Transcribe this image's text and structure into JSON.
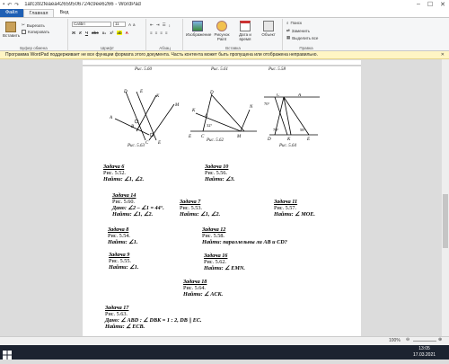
{
  "window": {
    "title": "1afc392feaea42659506724c9ee6266 - WordPad"
  },
  "tabs": [
    {
      "label": "Файл"
    },
    {
      "label": "Главная"
    },
    {
      "label": "Вид"
    }
  ],
  "ribbon": {
    "clipboard": {
      "label": "Буфер обмена",
      "paste": "Вставить",
      "cut": "Вырезать",
      "copy": "Копировать"
    },
    "font": {
      "label": "Шрифт",
      "family": "Calibri",
      "size": "11"
    },
    "paragraph": {
      "label": "Абзац"
    },
    "insert": {
      "label": "Вставка",
      "picture": "Изображение",
      "paint": "Рисунок Paint",
      "datetime": "Дата и время",
      "object": "Объект"
    },
    "edit": {
      "label": "Правка",
      "find": "Поиск",
      "replace": "Заменить",
      "select_all": "Выделить все"
    }
  },
  "infobar": {
    "message": "Программа WordPad поддерживает не все функции формата этого документа. Часть контента может быть пропущена или отображена неправильно."
  },
  "figures": {
    "fig560": "Рис. 5.60",
    "fig561": "Рис. 5.61",
    "fig558": "Рис. 5.58",
    "fig563": "Рис. 5.63",
    "fig562": "Рис. 5.62",
    "fig564": "Рис. 5.64",
    "labels": {
      "D": "D",
      "K": "K",
      "M": "M",
      "A": "A",
      "B": "B",
      "C": "C",
      "E": "E",
      "N": "N",
      "k1": "1",
      "k2": "2",
      "a32": "32°",
      "a70": "70°",
      "a58": "58°"
    }
  },
  "tasks": [
    {
      "title": "Задача 6",
      "line1": "Рис. 5.52.",
      "line2": "Найти: ∠1, ∠2."
    },
    {
      "title": "Задача 10",
      "line1": "Рис. 5.56.",
      "line2": "Найти: ∠3."
    },
    {
      "title": "Задача 14",
      "line1": "Рис. 5.60.",
      "line2": "Дано: ∠2 – ∠1 = 44°.",
      "line3": "Найти: ∠1, ∠2."
    },
    {
      "title": "Задача 7",
      "line1": "Рис. 5.53.",
      "line2": "Найти: ∠1, ∠2."
    },
    {
      "title": "Задача 11",
      "line1": "Рис. 5.57.",
      "line2": "Найти: ∠ MOE."
    },
    {
      "title": "Задача 8",
      "line1": "Рис. 5.54.",
      "line2": "Найти: ∠1."
    },
    {
      "title": "Задача 12",
      "line1": "Рис. 5.58.",
      "line2": "Найти: параллельны ли AB и CD?"
    },
    {
      "title": "Задача 9",
      "line1": "Рис. 5.55.",
      "line2": "Найти: ∠1."
    },
    {
      "title": "Задача 16",
      "line1": "Рис. 5.62.",
      "line2": "Найти: ∠ EMN."
    },
    {
      "title": "Задача 18",
      "line1": "Рис. 5.64.",
      "line2": "Найти: ∠ ACK."
    },
    {
      "title": "Задача 17",
      "line1": "Рис. 5.63.",
      "line2": "Дано: ∠ ABD : ∠ DBK = 1 : 2, DB || EC.",
      "line3": "Найти: ∠ ECB."
    }
  ],
  "status": {
    "zoom": "100%"
  },
  "taskbar": {
    "time": "13:05",
    "date": "17.03.2021"
  }
}
